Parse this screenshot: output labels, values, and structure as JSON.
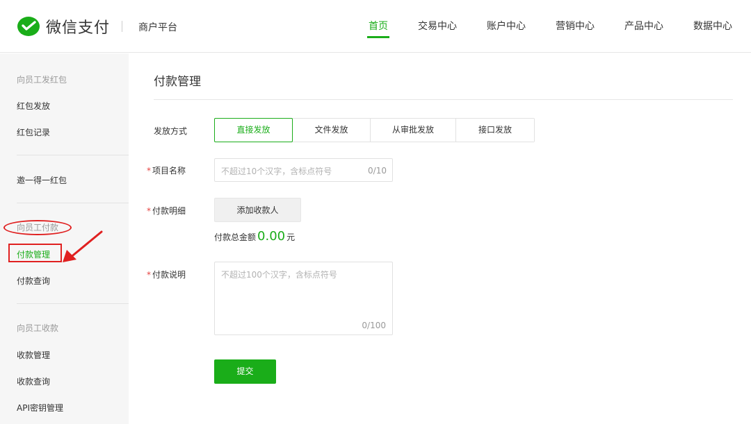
{
  "header": {
    "brand": "微信支付",
    "subtitle": "商户平台",
    "nav": [
      {
        "label": "首页",
        "active": true
      },
      {
        "label": "交易中心"
      },
      {
        "label": "账户中心"
      },
      {
        "label": "营销中心"
      },
      {
        "label": "产品中心"
      },
      {
        "label": "数据中心"
      }
    ]
  },
  "sidebar": {
    "section1_title": "向员工发红包",
    "section1_items": [
      "红包发放",
      "红包记录"
    ],
    "section2_items": [
      "邀一得一红包"
    ],
    "section3_title": "向员工付款",
    "section3_items": [
      "付款管理",
      "付款查询"
    ],
    "section4_title": "向员工收款",
    "section4_items": [
      "收款管理",
      "收款查询",
      "API密钥管理"
    ]
  },
  "main": {
    "title": "付款管理",
    "method_label": "发放方式",
    "methods": [
      "直接发放",
      "文件发放",
      "从审批发放",
      "接口发放"
    ],
    "project_label": "项目名称",
    "project_placeholder": "不超过10个汉字，含标点符号",
    "project_counter": "0/10",
    "detail_label": "付款明细",
    "add_payee": "添加收款人",
    "total_label": "付款总金额",
    "total_amount": "0.00",
    "total_unit": "元",
    "desc_label": "付款说明",
    "desc_placeholder": "不超过100个汉字，含标点符号",
    "desc_counter": "0/100",
    "submit": "提交"
  },
  "colors": {
    "accent": "#1aad19",
    "annotation": "#e02020",
    "required": "#e64340"
  }
}
